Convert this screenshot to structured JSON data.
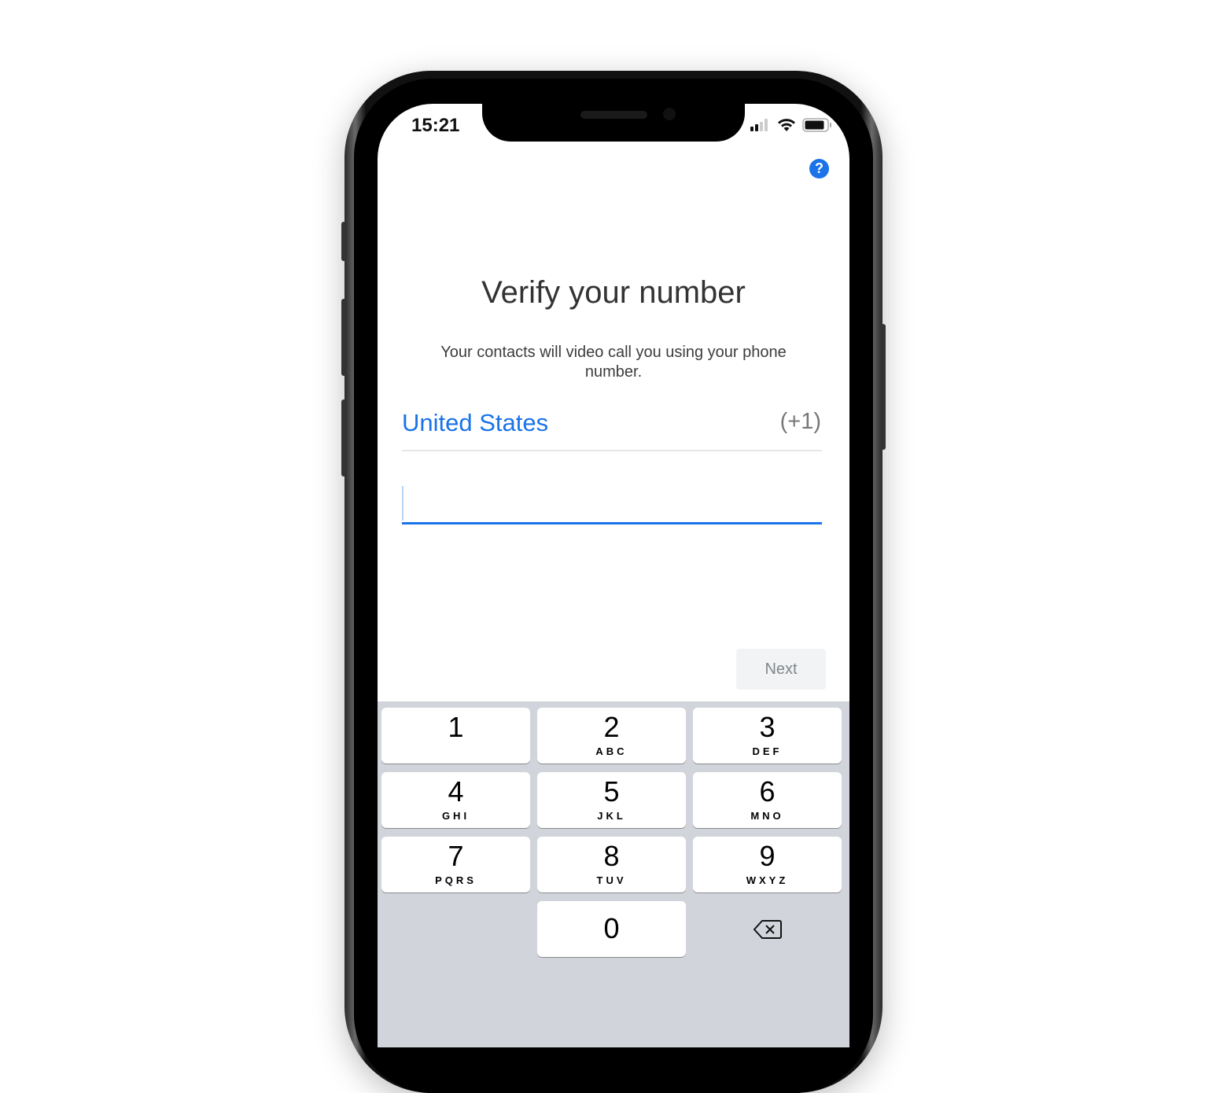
{
  "status_bar": {
    "time": "15:21",
    "icons": [
      "cellular-signal-icon",
      "wifi-icon",
      "battery-icon"
    ]
  },
  "header": {
    "help_icon": "?"
  },
  "main": {
    "title": "Verify your number",
    "subtitle": "Your contacts will video call you using your phone number.",
    "country": "United States",
    "country_code": "(+1)",
    "phone_input": {
      "value": "",
      "placeholder": ""
    },
    "next_label": "Next"
  },
  "keypad": {
    "keys": [
      {
        "digit": "1",
        "letters": ""
      },
      {
        "digit": "2",
        "letters": "ABC"
      },
      {
        "digit": "3",
        "letters": "DEF"
      },
      {
        "digit": "4",
        "letters": "GHI"
      },
      {
        "digit": "5",
        "letters": "JKL"
      },
      {
        "digit": "6",
        "letters": "MNO"
      },
      {
        "digit": "7",
        "letters": "PQRS"
      },
      {
        "digit": "8",
        "letters": "TUV"
      },
      {
        "digit": "9",
        "letters": "WXYZ"
      },
      {
        "digit": "0",
        "letters": ""
      }
    ],
    "delete_icon": "backspace-icon"
  },
  "colors": {
    "accent": "#1a73e8",
    "keyboard_bg": "#d1d5db",
    "next_bg": "#f1f3f4"
  }
}
